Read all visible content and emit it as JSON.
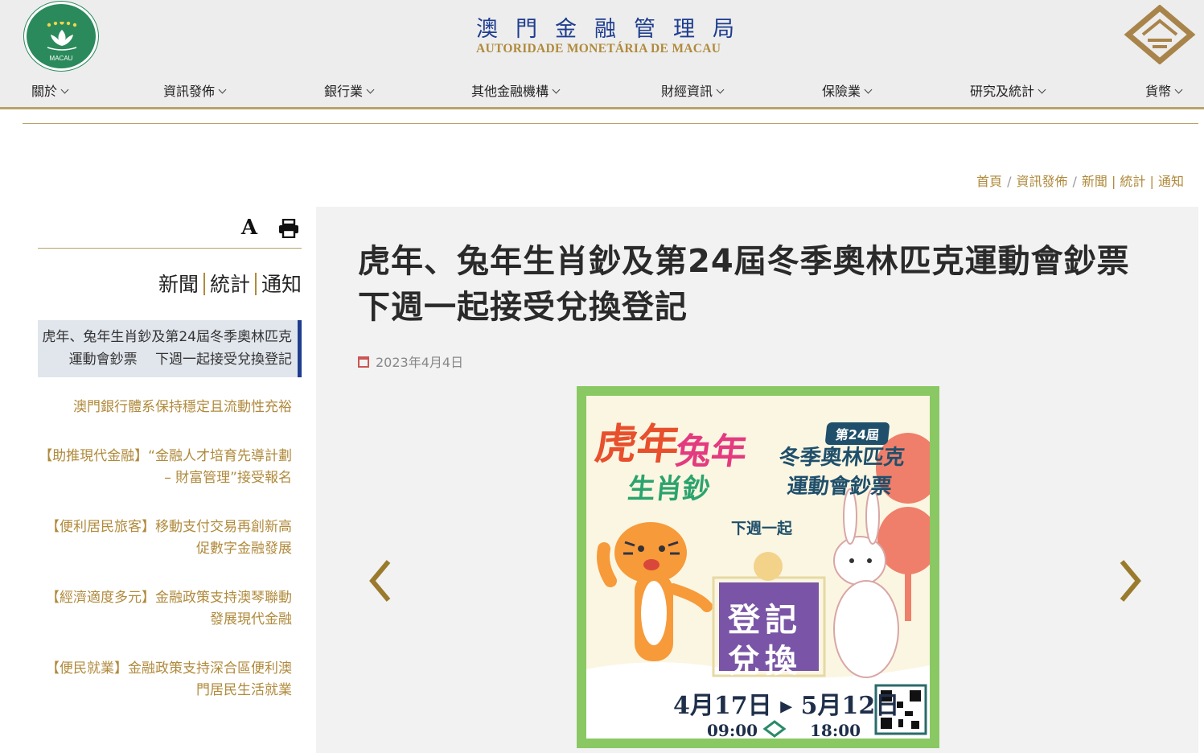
{
  "header": {
    "title_cn": "澳門金融管理局",
    "title_pt": "AUTORIDADE MONETÁRIA DE MACAU",
    "emblem_text": "MACAU"
  },
  "nav": {
    "items": [
      {
        "label": "關於"
      },
      {
        "label": "資訊發佈"
      },
      {
        "label": "銀行業"
      },
      {
        "label": "其他金融機構"
      },
      {
        "label": "財經資訊"
      },
      {
        "label": "保險業"
      },
      {
        "label": "研究及統計"
      },
      {
        "label": "貨幣"
      }
    ]
  },
  "breadcrumb": {
    "home": "首頁",
    "section": "資訊發佈",
    "page": "新聞 | 統計 | 通知"
  },
  "sidebar": {
    "font_icon": "A",
    "title_parts": [
      "新聞",
      "統計",
      "通知"
    ],
    "items": [
      {
        "label": "虎年、兔年生肖鈔及第24屆冬季奧林匹克運動會鈔票　 下週一起接受兌換登記"
      },
      {
        "label": "澳門銀行體系保持穩定且流動性充裕"
      },
      {
        "label": "【助推現代金融】“金融人才培育先導計劃 – 財富管理”接受報名"
      },
      {
        "label": "【便利居民旅客】移動支付交易再創新高促數字金融發展"
      },
      {
        "label": "【經濟適度多元】金融政策支持澳琴聯動發展現代金融"
      },
      {
        "label": "【便民就業】金融政策支持深合區便利澳門居民生活就業"
      }
    ]
  },
  "article": {
    "title": "虎年、兔年生肖鈔及第24屆冬季奧林匹克運動會鈔票　 下週一起接受兌換登記",
    "date": "2023年4月4日"
  },
  "poster": {
    "tiger": "虎年",
    "rabbit": "兔年",
    "zodiac": "生肖鈔",
    "session": "第24屆",
    "olympic_line1": "冬季奧林匹克",
    "olympic_line2": "運動會鈔票",
    "next_monday": "下週一起",
    "register_line1": "登記",
    "register_line2": "兌換",
    "dates": "4月17日 ▸ 5月12日",
    "start_time": "09:00",
    "end_time": "18:00"
  },
  "colors": {
    "gold": "#b08a3c",
    "navy": "#1e3d8f",
    "poster_border": "#8ac863"
  }
}
